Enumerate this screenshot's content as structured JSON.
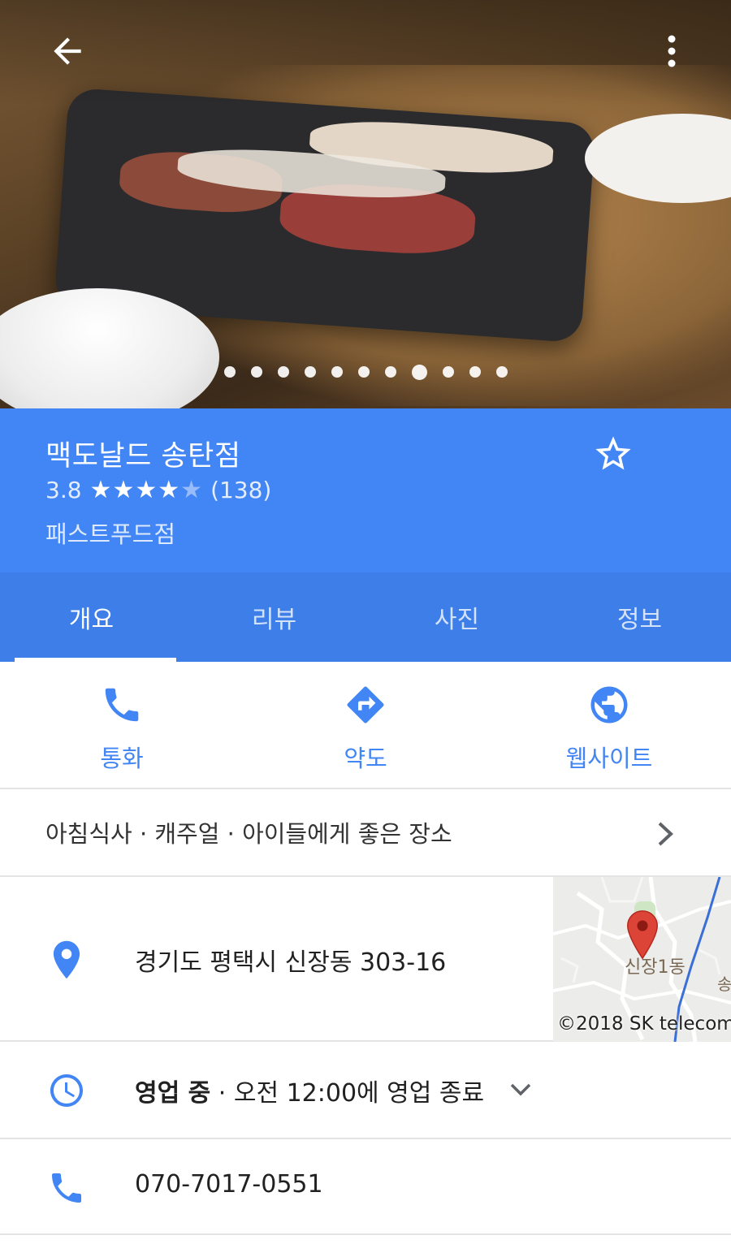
{
  "hero": {
    "photo_count": 11,
    "active_photo_index": 7,
    "back_icon": "arrow-back-icon",
    "more_icon": "more-vert-icon"
  },
  "place": {
    "name": "맥도날드 송탄점",
    "rating": "3.8",
    "rating_value": 3.8,
    "review_count": "(138)",
    "category": "패스트푸드점",
    "save_icon": "star-outline-icon"
  },
  "tabs": [
    {
      "label": "개요",
      "active": true
    },
    {
      "label": "리뷰",
      "active": false
    },
    {
      "label": "사진",
      "active": false
    },
    {
      "label": "정보",
      "active": false
    }
  ],
  "actions": [
    {
      "label": "통화",
      "icon": "phone-icon"
    },
    {
      "label": "약도",
      "icon": "directions-icon"
    },
    {
      "label": "웹사이트",
      "icon": "globe-icon"
    }
  ],
  "attributes": {
    "text": "아침식사 · 캐주얼 · 아이들에게 좋은 장소"
  },
  "address": {
    "text": "경기도 평택시 신장동 303-16",
    "map_label": "신장1동",
    "map_label_2": "송",
    "map_copyright": "©2018 SK telecom"
  },
  "hours": {
    "status": "영업 중",
    "detail": " · 오전 12:00에 영업 종료"
  },
  "phone": {
    "number": "070-7017-0551"
  },
  "colors": {
    "header_blue": "#4285f4",
    "tab_blue": "#3d7ee8",
    "accent_blue": "#4285f4",
    "map_pin_red": "#db4437"
  }
}
